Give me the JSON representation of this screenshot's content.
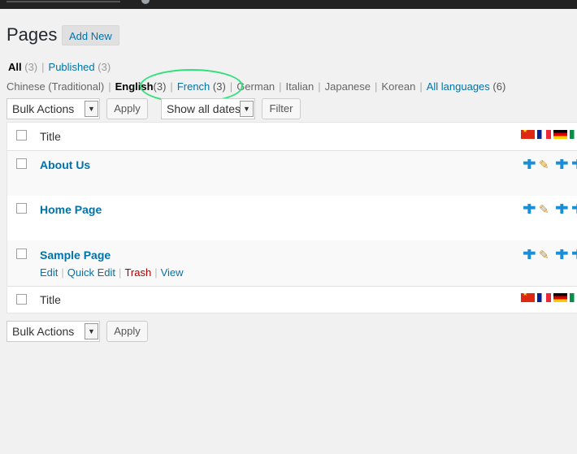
{
  "header": {
    "title": "Pages",
    "add_new": "Add New"
  },
  "status_filters": {
    "all_label": "All",
    "all_count": "(3)",
    "sep": "|",
    "published_label": "Published",
    "published_count": "(3)"
  },
  "languages": {
    "items": [
      {
        "label": "Chinese (Traditional)"
      },
      {
        "label": "English",
        "count": "(3)"
      },
      {
        "label": "French",
        "count": "(3)"
      },
      {
        "label": "German"
      },
      {
        "label": "Italian"
      },
      {
        "label": "Japanese"
      },
      {
        "label": "Korean"
      },
      {
        "label": "All languages",
        "count": "(6)"
      }
    ],
    "sep": "|"
  },
  "top_nav": {
    "bulk_actions": "Bulk Actions",
    "apply": "Apply",
    "dates": "Show all dates",
    "filter": "Filter"
  },
  "table": {
    "column_title": "Title",
    "rows": [
      {
        "title": "About Us"
      },
      {
        "title": "Home Page"
      },
      {
        "title": "Sample Page",
        "actions": {
          "edit": "Edit",
          "quick_edit": "Quick Edit",
          "trash": "Trash",
          "view": "View"
        }
      }
    ]
  },
  "bottom_nav": {
    "bulk_actions": "Bulk Actions",
    "apply": "Apply"
  },
  "icons": {
    "dropdown": "▼",
    "plus": "✚",
    "pencil": "✎"
  },
  "colors": {
    "link": "#0073aa",
    "trash": "#aa0000",
    "highlight_ring": "#32e07a",
    "plus_icon": "#1b8ed6"
  }
}
